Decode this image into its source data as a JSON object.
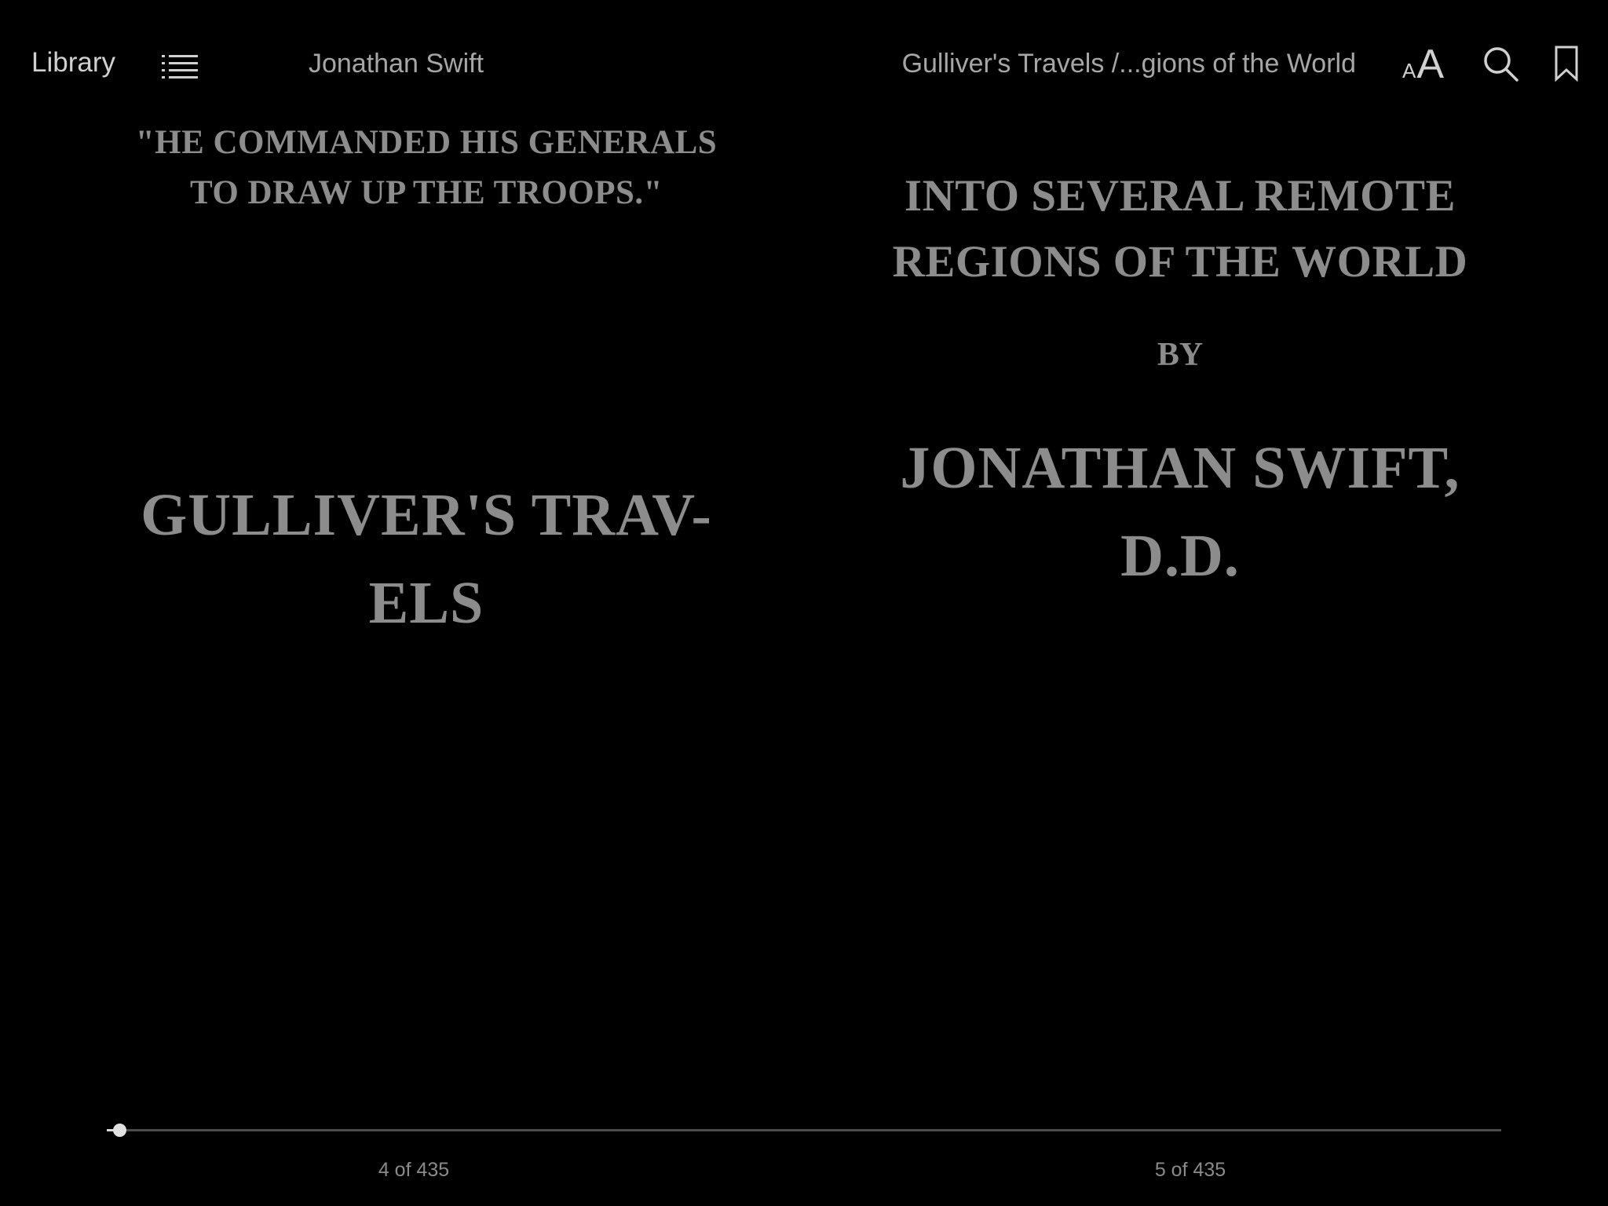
{
  "toolbar": {
    "library_label": "Library",
    "toc_icon": "list-icon",
    "author": "Jonathan Swift",
    "book_title": "Gulliver's Travels /...gions of the World",
    "font_small_a": "A",
    "font_big_a": "A",
    "font_icon": "text-size-icon",
    "search_icon": "search-icon",
    "bookmark_icon": "bookmark-icon"
  },
  "left_page": {
    "epigraph_line1": "\"HE COMMANDED HIS GENERALS",
    "epigraph_line2": "TO DRAW UP THE TROOPS.\"",
    "title_line1": "GULLIVER'S TRAV-",
    "title_line2": "ELS",
    "page_number": "4 of 435"
  },
  "right_page": {
    "subtitle_line1": "INTO SEVERAL REMOTE",
    "subtitle_line2": "REGIONS OF THE WORLD",
    "by": "BY",
    "author_line1": "JONATHAN SWIFT,",
    "author_line2": "D.D.",
    "page_number": "5 of 435"
  },
  "progress": {
    "current_page": 4,
    "total_pages": 435,
    "fraction": 0.0092
  },
  "colors": {
    "background": "#000000",
    "toolbar_text": "#d0d0d0",
    "page_text": "#8c8c8c",
    "scrubber_track": "#4a4a4a",
    "scrubber_knob": "#e0e0e0"
  }
}
